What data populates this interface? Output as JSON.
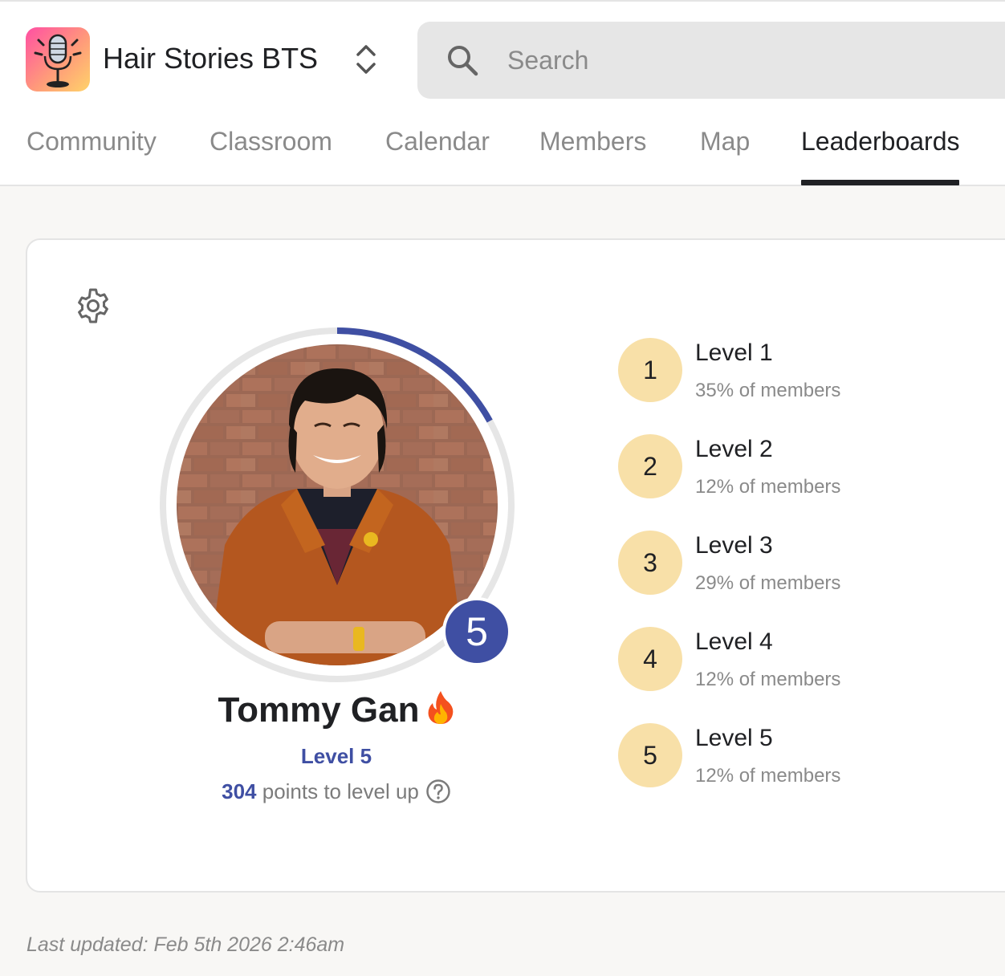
{
  "header": {
    "app_title": "Hair Stories BTS",
    "logo_icon": "microphone-icon",
    "switcher_icon": "chevron-up-down-icon",
    "search": {
      "placeholder": "Search",
      "value": "",
      "icon": "search-icon"
    }
  },
  "tabs": [
    {
      "label": "Community",
      "active": false
    },
    {
      "label": "Classroom",
      "active": false
    },
    {
      "label": "Calendar",
      "active": false
    },
    {
      "label": "Members",
      "active": false
    },
    {
      "label": "Map",
      "active": false
    },
    {
      "label": "Leaderboards",
      "active": true
    }
  ],
  "profile": {
    "settings_icon": "gear-icon",
    "name": "Tommy Gan",
    "name_emoji_icon": "fire-icon",
    "level_badge": "5",
    "level_label": "Level 5",
    "points_to_level_up": "304",
    "points_suffix": "points to level up",
    "help_icon": "question-circle-icon",
    "level_progress_fraction": 0.17
  },
  "levels": [
    {
      "number": "1",
      "name": "Level 1",
      "share": "35% of members"
    },
    {
      "number": "2",
      "name": "Level 2",
      "share": "12% of members"
    },
    {
      "number": "3",
      "name": "Level 3",
      "share": "29% of members"
    },
    {
      "number": "4",
      "name": "Level 4",
      "share": "12% of members"
    },
    {
      "number": "5",
      "name": "Level 5",
      "share": "12% of members"
    }
  ],
  "footer": {
    "last_updated": "Last updated: Feb 5th 2026 2:46am"
  },
  "colors": {
    "accent": "#3f4fa3",
    "level_circle": "#f8e0a8",
    "muted_text": "#8a8a8a",
    "ring_track": "#e6e6e6"
  }
}
